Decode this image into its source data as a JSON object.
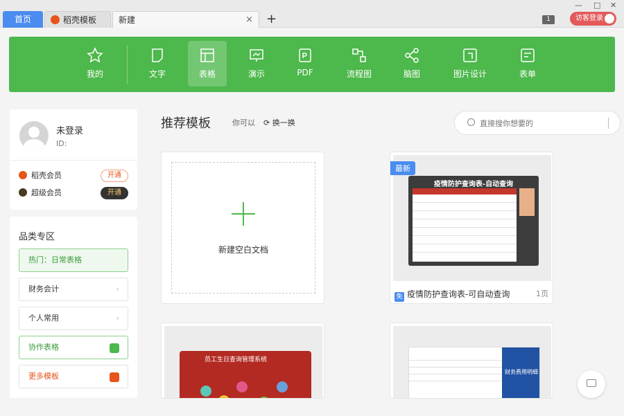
{
  "tabs": {
    "home": "首页",
    "template": "稻壳模板",
    "new": "新建",
    "close": "×",
    "add": "+"
  },
  "titlebar": {
    "badge": "1",
    "visitor_login": "访客登录",
    "minimize": "—",
    "maximize": "□",
    "close": "✕"
  },
  "toolbar": {
    "items": [
      {
        "label": "我的",
        "icon": "star-icon"
      },
      {
        "label": "文字",
        "icon": "doc-icon"
      },
      {
        "label": "表格",
        "icon": "table-icon"
      },
      {
        "label": "演示",
        "icon": "presentation-icon"
      },
      {
        "label": "PDF",
        "icon": "pdf-icon"
      },
      {
        "label": "流程图",
        "icon": "flowchart-icon"
      },
      {
        "label": "脑图",
        "icon": "mindmap-icon"
      },
      {
        "label": "图片设计",
        "icon": "image-design-icon"
      },
      {
        "label": "表单",
        "icon": "form-icon"
      }
    ],
    "active": "表格",
    "accent": "#4db84b"
  },
  "user": {
    "name": "未登录",
    "id_label": "ID:",
    "memberships": [
      {
        "label": "稻壳会员",
        "button": "开通"
      },
      {
        "label": "超级会员",
        "button": "开通"
      }
    ]
  },
  "categories": {
    "title": "品类专区",
    "items": [
      "热门：日常表格",
      "财务会计",
      "个人常用",
      "协作表格",
      "更多模板"
    ]
  },
  "main": {
    "title": "推荐模板",
    "hint": "你可以",
    "swap": "换一换",
    "search_placeholder": "直接搜你想要的"
  },
  "templates": {
    "new_blank": "新建空白文档",
    "t1": {
      "tag": "最新",
      "header": "疫情防护查询表-自动查询",
      "name": "疫情防护查询表-可自动查询",
      "pages": "1页",
      "badge": "免"
    },
    "t2": {
      "header": "员工生日查询管理系统"
    },
    "t3": {
      "side": "财务费用明细"
    }
  }
}
